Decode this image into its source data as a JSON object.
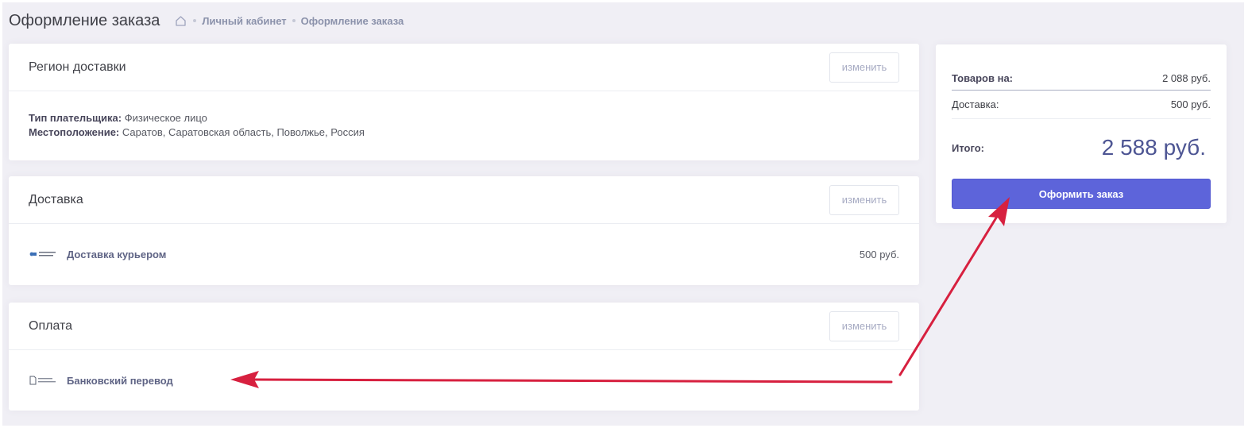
{
  "header": {
    "title": "Оформление заказа",
    "breadcrumb": [
      "Личный кабинет",
      "Оформление заказа"
    ]
  },
  "region": {
    "title": "Регион доставки",
    "change_label": "изменить",
    "payer_type_label": "Тип плательщика:",
    "payer_type_value": "Физическое лицо",
    "location_label": "Местоположение:",
    "location_value": "Саратов, Саратовская область, Поволжье, Россия"
  },
  "delivery": {
    "title": "Доставка",
    "change_label": "изменить",
    "method": "Доставка курьером",
    "price": "500 руб."
  },
  "payment": {
    "title": "Оплата",
    "change_label": "изменить",
    "method": "Банковский перевод"
  },
  "summary": {
    "goods_label": "Товаров на:",
    "goods_value": "2 088 руб.",
    "delivery_label": "Доставка:",
    "delivery_value": "500 руб.",
    "total_label": "Итого:",
    "total_value": "2 588 руб.",
    "order_button": "Оформить заказ"
  },
  "colors": {
    "accent": "#5d64da",
    "background": "#f0eff5",
    "annotation_arrow": "#d7203f"
  }
}
